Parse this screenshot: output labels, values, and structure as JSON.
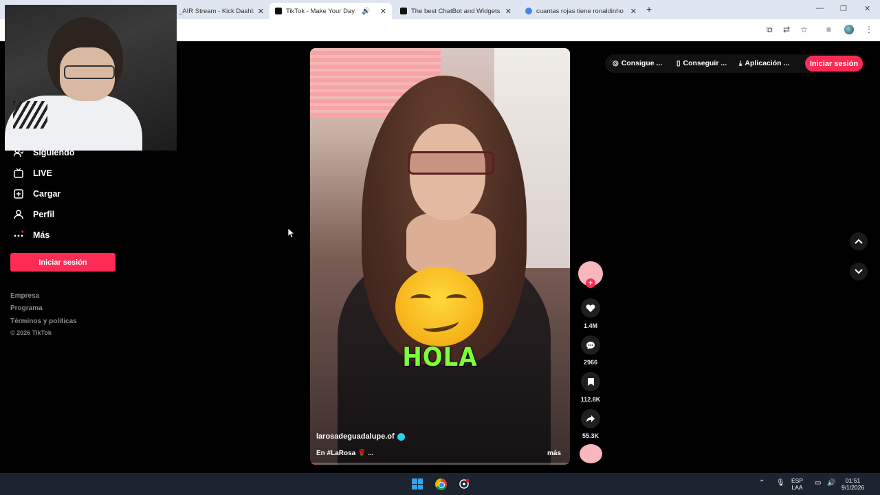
{
  "browser": {
    "tabs": [
      {
        "title": "_AIR Stream - Kick Dashb",
        "color": "#53fc18",
        "active": false
      },
      {
        "title": "TikTok - Make Your Day",
        "color": "#111111",
        "active": true
      },
      {
        "title": "The best ChatBot and Widgets",
        "color": "#111111",
        "active": false
      },
      {
        "title": "cuantas rojas tiene ronaldinho",
        "color": "#4285f4",
        "active": false
      }
    ],
    "new_tab": "+",
    "close_glyph": "✕",
    "window_controls": {
      "minimize": "—",
      "restore": "❐",
      "close": "✕"
    }
  },
  "sidebar": {
    "items": [
      {
        "label": "Siguiendo",
        "icon": "following-icon"
      },
      {
        "label": "LIVE",
        "icon": "live-icon"
      },
      {
        "label": "Cargar",
        "icon": "upload-icon"
      },
      {
        "label": "Perfil",
        "icon": "profile-icon"
      },
      {
        "label": "Más",
        "icon": "more-icon"
      }
    ],
    "login_label": "Iniciar sesión",
    "footer": {
      "links": [
        "Empresa",
        "Programa",
        "Términos y políticas"
      ],
      "copyright": "© 2026 TikTok"
    }
  },
  "header": {
    "coins_label": "Consigue ...",
    "get_app_label": "Conseguir ...",
    "download_label": "Aplicación ...",
    "login_label": "Iniciar sesión"
  },
  "video": {
    "overlay_text": "HOLA",
    "username": "larosadeguadalupe.of",
    "description": "En #LaRosa 🌹 ...",
    "more_label": "más",
    "progress": 0.02
  },
  "actions": {
    "likes": "1.4M",
    "comments": "2966",
    "saves": "112.8K",
    "shares": "55.3K"
  },
  "taskbar": {
    "lang_top": "ESP",
    "lang_bottom": "LAA",
    "time": "01:51",
    "date": "9/1/2026"
  },
  "colors": {
    "accent": "#fe2c55",
    "taskbar": "#1c2430",
    "tabstrip": "#dfe6f1"
  }
}
